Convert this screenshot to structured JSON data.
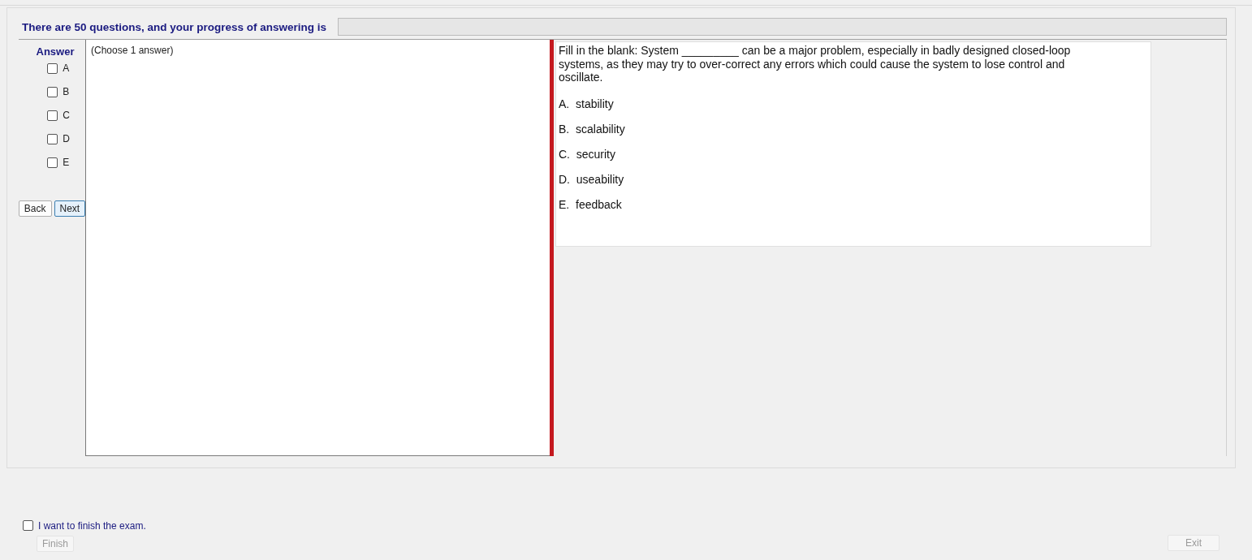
{
  "header": {
    "text": "There are 50 questions, and your progress of answering is",
    "progress": {
      "level": 0
    }
  },
  "answer_panel": {
    "title": "Answer",
    "options": [
      {
        "label": "A",
        "checked": false
      },
      {
        "label": "B",
        "checked": false
      },
      {
        "label": "C",
        "checked": false
      },
      {
        "label": "D",
        "checked": false
      },
      {
        "label": "E",
        "checked": false
      }
    ],
    "buttons": [
      {
        "label": "Back",
        "focused": false
      },
      {
        "label": "Next",
        "focused": true
      }
    ]
  },
  "instruction": "(Choose 1 answer)",
  "question": {
    "text": "Fill in the blank: System _________ can be a major problem, especially in badly designed closed-loop systems, as they may try to over-correct any errors which could cause the system to lose control and oscillate.",
    "choices": [
      {
        "letter": "A.",
        "text": "stability"
      },
      {
        "letter": "B.",
        "text": "scalability"
      },
      {
        "letter": "C.",
        "text": "security"
      },
      {
        "letter": "D.",
        "text": "useability"
      },
      {
        "letter": "E.",
        "text": "feedback"
      }
    ]
  },
  "finish": {
    "label": "I want to finish the exam.",
    "checked": false,
    "button": {
      "label": "Finish",
      "disabled": true
    }
  },
  "exit_button": {
    "label": "Exit",
    "disabled": true
  }
}
